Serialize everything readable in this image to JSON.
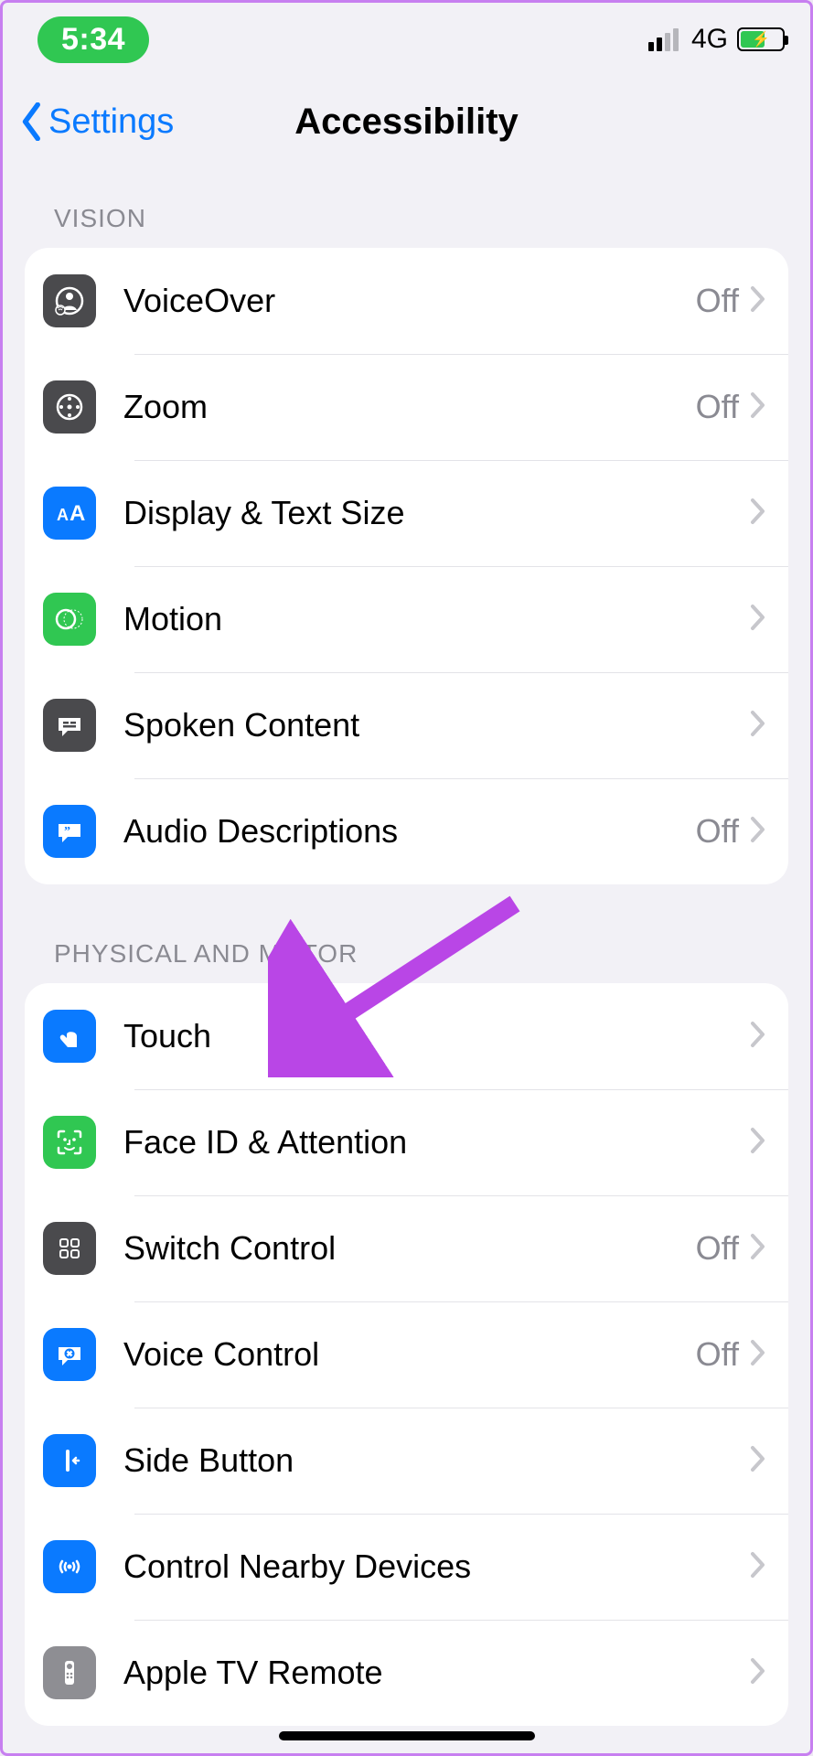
{
  "status": {
    "time": "5:34",
    "network_label": "4G"
  },
  "nav": {
    "back_label": "Settings",
    "title": "Accessibility"
  },
  "sections": {
    "vision": {
      "label": "VISION",
      "items": {
        "voiceover": {
          "label": "VoiceOver",
          "value": "Off"
        },
        "zoom": {
          "label": "Zoom",
          "value": "Off"
        },
        "display_text": {
          "label": "Display & Text Size",
          "value": ""
        },
        "motion": {
          "label": "Motion",
          "value": ""
        },
        "spoken_content": {
          "label": "Spoken Content",
          "value": ""
        },
        "audio_desc": {
          "label": "Audio Descriptions",
          "value": "Off"
        }
      }
    },
    "physical": {
      "label": "PHYSICAL AND MOTOR",
      "items": {
        "touch": {
          "label": "Touch",
          "value": ""
        },
        "faceid": {
          "label": "Face ID & Attention",
          "value": ""
        },
        "switch_control": {
          "label": "Switch Control",
          "value": "Off"
        },
        "voice_control": {
          "label": "Voice Control",
          "value": "Off"
        },
        "side_button": {
          "label": "Side Button",
          "value": ""
        },
        "nearby": {
          "label": "Control Nearby Devices",
          "value": ""
        },
        "apple_tv": {
          "label": "Apple TV Remote",
          "value": ""
        }
      }
    }
  },
  "annotation": {
    "color": "#b946e6"
  }
}
